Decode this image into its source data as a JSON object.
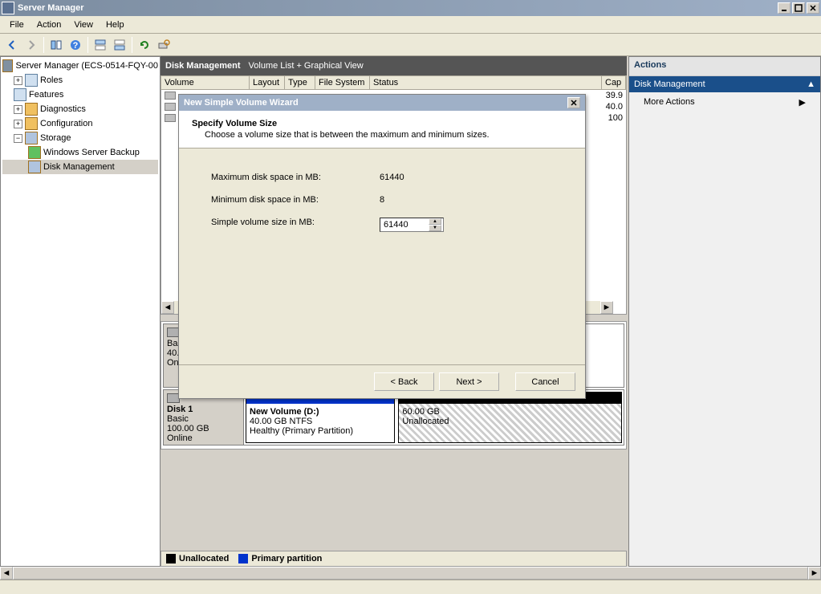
{
  "window": {
    "title": "Server Manager"
  },
  "menu": {
    "file": "File",
    "action": "Action",
    "view": "View",
    "help": "Help"
  },
  "tree": {
    "root": "Server Manager (ECS-0514-FQY-00",
    "roles": "Roles",
    "features": "Features",
    "diagnostics": "Diagnostics",
    "configuration": "Configuration",
    "storage": "Storage",
    "wsb": "Windows Server Backup",
    "diskmgmt": "Disk Management"
  },
  "dm": {
    "title": "Disk Management",
    "subtitle": "Volume List + Graphical View",
    "cols": {
      "volume": "Volume",
      "layout": "Layout",
      "type": "Type",
      "fs": "File System",
      "status": "Status",
      "cap": "Cap"
    },
    "rows": {
      "r0cap": "39.9",
      "r1cap": "40.0",
      "r2cap": "100"
    }
  },
  "disk1": {
    "name": "Disk 1",
    "type": "Basic",
    "size": "100.00 GB",
    "state": "Online",
    "p1name": "New Volume  (D:)",
    "p1size": "40.00 GB NTFS",
    "p1status": "Healthy (Primary Partition)",
    "p2size": "60.00 GB",
    "p2status": "Unallocated"
  },
  "disk0_partial": {
    "type": "Bas",
    "size": "40.",
    "state": "On"
  },
  "legend": {
    "unalloc": "Unallocated",
    "primary": "Primary partition"
  },
  "actions": {
    "header": "Actions",
    "section": "Disk Management",
    "more": "More Actions"
  },
  "wizard": {
    "title": "New Simple Volume Wizard",
    "heading": "Specify Volume Size",
    "desc": "Choose a volume size that is between the maximum and minimum sizes.",
    "max_label": "Maximum disk space in MB:",
    "max_value": "61440",
    "min_label": "Minimum disk space in MB:",
    "min_value": "8",
    "size_label": "Simple volume size in MB:",
    "size_value": "61440",
    "back": "< Back",
    "next": "Next >",
    "cancel": "Cancel"
  }
}
